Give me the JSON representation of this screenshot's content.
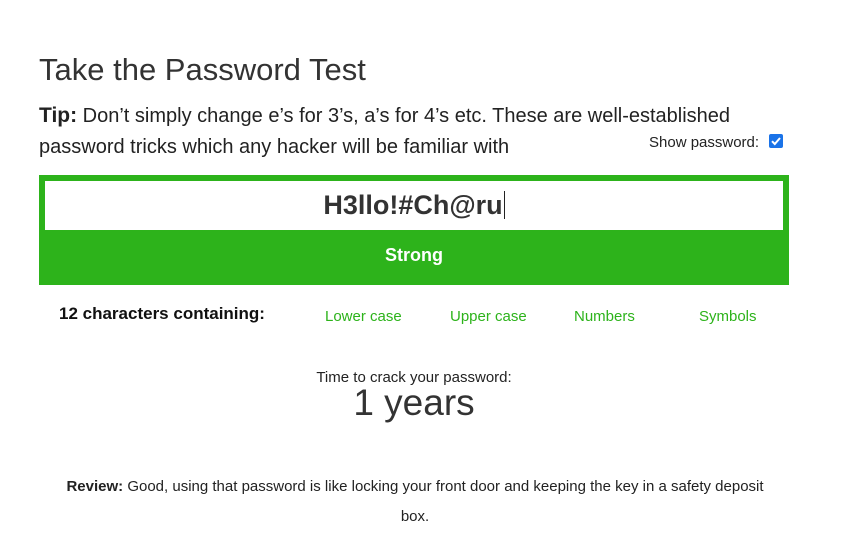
{
  "title": "Take the Password Test",
  "tip": {
    "label": "Tip:",
    "text": "Don’t simply change e’s for 3’s, a’s for 4’s etc. These are well-established password tricks which any hacker will be familiar with"
  },
  "show_password": {
    "label": "Show password:",
    "checked": true
  },
  "password": {
    "value": "H3llo!#Ch@ru"
  },
  "strength": {
    "label": "Strong",
    "color": "#2db31b"
  },
  "criteria": {
    "summary": "12 characters containing:",
    "items": [
      "Lower case",
      "Upper case",
      "Numbers",
      "Symbols"
    ]
  },
  "crack_time": {
    "label": "Time to crack your password:",
    "value": "1 years"
  },
  "review": {
    "label": "Review:",
    "text": "Good, using that password is like locking your front door and keeping the key in a safety deposit box."
  }
}
